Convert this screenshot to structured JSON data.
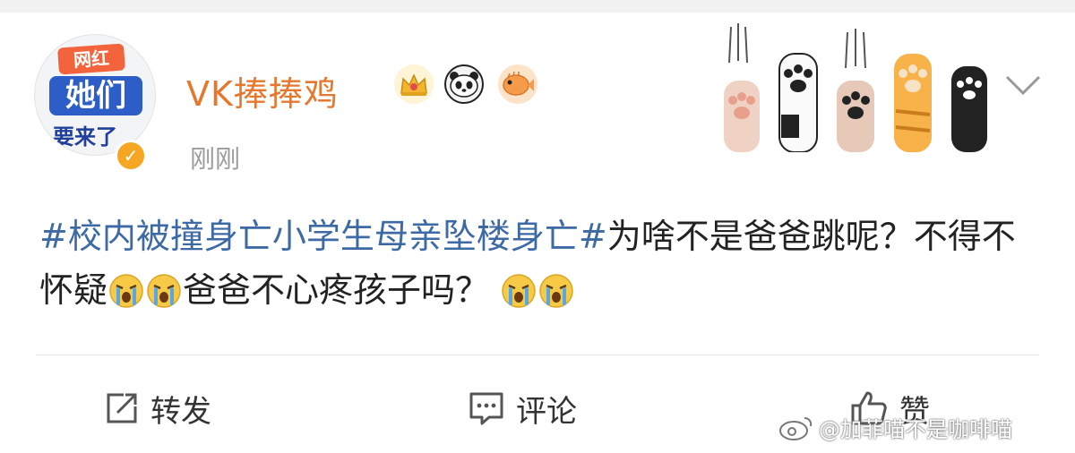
{
  "post": {
    "author": {
      "name": "VK捧捧鸡",
      "avatar_text": {
        "tag": "网红",
        "main": "她们",
        "sub": "要来了"
      },
      "verified_mark": "✓",
      "badges": [
        "crown-icon",
        "panda-icon",
        "pufferfish-icon"
      ]
    },
    "timestamp": "刚刚",
    "decoration": "cat-paws",
    "content": {
      "hashtag": "#校内被撞身亡小学生母亲坠楼身亡#",
      "text_part1": "为啥不是爸爸跳呢？不得不怀疑",
      "text_part2": "爸爸不心疼孩子吗？",
      "emoji": "crying-face-icon"
    },
    "actions": {
      "repost_label": "转发",
      "comment_label": "评论",
      "like_label": "赞"
    }
  },
  "watermark": {
    "text": "@加菲喵不是咖啡喵",
    "icon": "weibo-icon"
  },
  "colors": {
    "username": "#e5782e",
    "hashtag": "#3d6aa5",
    "text": "#222222",
    "timestamp": "#9b9b9b",
    "divider": "#e6e6e6"
  }
}
